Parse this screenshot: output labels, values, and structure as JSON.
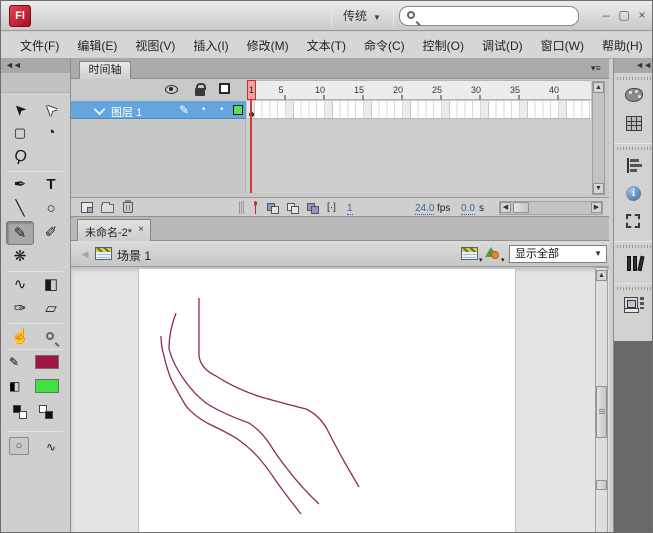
{
  "window": {
    "logo_text": "Fl",
    "workspace_label": "传统",
    "search_value": "",
    "controls": {
      "minimize": "–",
      "maximize": "▢",
      "close": "×"
    }
  },
  "icons": {
    "collapse_double_arrow": "◄◄",
    "dropdown_arrow": "▼",
    "small_arrow": "▾",
    "up_arrow": "▲",
    "down_arrow": "▼",
    "left_arrow": "◀",
    "right_arrow": "▶",
    "back_arrow": "◄",
    "panel_menu": "▾≡",
    "dot": "•",
    "search_magnifier": "magnifier",
    "marker_brackets": "[·]"
  },
  "menu": {
    "items": [
      "文件(F)",
      "编辑(E)",
      "视图(V)",
      "插入(I)",
      "修改(M)",
      "文本(T)",
      "命令(C)",
      "控制(O)",
      "调试(D)",
      "窗口(W)",
      "帮助(H)"
    ]
  },
  "tools": {
    "selection": "➤",
    "subselection": "➤",
    "free_transform": "▢",
    "rotation_3d": "◔",
    "lasso": "Ϙ",
    "pen": "✒",
    "text": "T",
    "line": "╲",
    "oval": "○",
    "pencil": "✎",
    "brush": "✐",
    "deco": "❋",
    "bone": "∿",
    "paint_bucket": "◧",
    "eyedropper": "✑",
    "eraser": "▱",
    "hand": "☝",
    "object_drawing": "○",
    "smooth": "∿"
  },
  "timeline": {
    "tab_label": "时间轴",
    "layer_name": "图层 1",
    "ruler": [
      "1",
      "5",
      "10",
      "15",
      "20",
      "25",
      "30",
      "35",
      "40"
    ],
    "current_frame": "1",
    "frame_rate_value": "24.0",
    "frame_rate_unit": "fps",
    "elapsed_value": "0.0",
    "elapsed_unit": "s"
  },
  "document": {
    "tab_title": "未命名-2*",
    "tab_close": "×"
  },
  "edit_bar": {
    "scene_label": "场景 1",
    "zoom_value": "显示全部"
  },
  "colors": {
    "stroke_swatch": "#A21445",
    "fill_swatch": "#3FE23F",
    "layer_selection_blue": "#63A5DC",
    "playhead_red": "#CF3A3A",
    "curve_stroke": "#8E2B4B"
  },
  "stage": {
    "curves": [
      "M128,31 L128,89 Q130,102 145,109 Q165,122 190,130 Q215,137 235,142 Q248,148 256,162 Q264,178 274,196 L288,220",
      "M105,46 Q98,64 98,82 Q102,97 112,111 Q122,126 135,136 Q150,146 178,156 Q190,164 198,176 Q208,192 218,204 Q230,220 248,237",
      "M90,69 Q90,79 93,89 Q96,102 100,112 Q106,124 115,139 Q124,150 140,158 Q155,165 165,171 Q178,180 186,189 Q196,200 205,214 Q215,228 230,247"
    ]
  }
}
